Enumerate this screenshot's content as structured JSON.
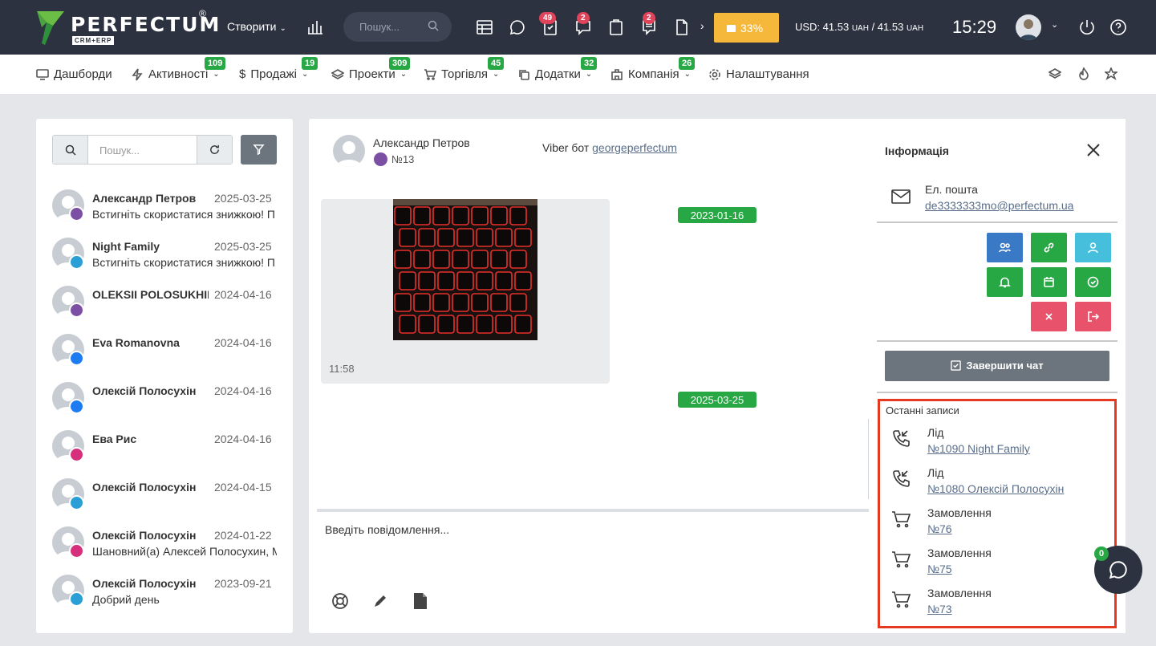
{
  "topbar": {
    "logo_text": "PERFECTUM",
    "logo_reg": "®",
    "logo_sub": "CRM+ERP",
    "create_label": "Створити",
    "search_placeholder": "Пошук...",
    "badge_tasks": "49",
    "badge_messages": "2",
    "badge_notes": "2",
    "progress_label": "33%",
    "currency_label": "USD: 41.53",
    "currency_unit1": "UAH",
    "currency_sep": " / 41.53 ",
    "currency_unit2": "UAH",
    "time": "15:29",
    "accent": "#f5b83a"
  },
  "nav": {
    "items": [
      {
        "label": "Дашборди",
        "icon": "monitor-icon",
        "badge": ""
      },
      {
        "label": "Активності",
        "icon": "bolt-icon",
        "badge": "109"
      },
      {
        "label": "Продажі",
        "icon": "dollar-icon",
        "badge": "19"
      },
      {
        "label": "Проекти",
        "icon": "layers-icon",
        "badge": "309"
      },
      {
        "label": "Торгівля",
        "icon": "cart-icon",
        "badge": "45"
      },
      {
        "label": "Додатки",
        "icon": "copy-icon",
        "badge": "32"
      },
      {
        "label": "Компанія",
        "icon": "building-icon",
        "badge": "26"
      },
      {
        "label": "Налаштування",
        "icon": "gear-icon",
        "badge": ""
      }
    ]
  },
  "chatlist": {
    "search_placeholder": "Пошук...",
    "items": [
      {
        "name": "Александр Петров",
        "date": "2025-03-25",
        "message": "Встигніть скористатися знижкою! П",
        "source": "viber-icon",
        "color": "#7b4fa3"
      },
      {
        "name": "Night Family",
        "date": "2025-03-25",
        "message": "Встигніть скористатися знижкою! П",
        "source": "telegram-icon",
        "color": "#2a9fd6"
      },
      {
        "name": "OLEKSII POLOSUKHIN",
        "date": "2024-04-16",
        "message": "",
        "source": "viber-icon",
        "color": "#7b4fa3"
      },
      {
        "name": "Eva Romanovna",
        "date": "2024-04-16",
        "message": "",
        "source": "messenger-icon",
        "color": "#1e7cf2"
      },
      {
        "name": "Олексій Полосухін",
        "date": "2024-04-16",
        "message": "",
        "source": "messenger-icon",
        "color": "#1e7cf2"
      },
      {
        "name": "Ева Рис",
        "date": "2024-04-16",
        "message": "",
        "source": "instagram-icon",
        "color": "#d6307c"
      },
      {
        "name": "Олексій Полосухін",
        "date": "2024-04-15",
        "message": "",
        "source": "telegram-icon",
        "color": "#2a9fd6"
      },
      {
        "name": "Олексій Полосухін",
        "date": "2024-01-22",
        "message": "Шановний(а) Алексей Полосухин, М",
        "source": "instagram-icon",
        "color": "#d6307c"
      },
      {
        "name": "Олексій Полосухін",
        "date": "2023-09-21",
        "message": "Добрий день",
        "source": "telegram-icon",
        "color": "#2a9fd6"
      }
    ]
  },
  "chat": {
    "contact_name": "Александр Петров",
    "contact_number": "№13",
    "bot_label": "Viber бот",
    "bot_link": "georgeperfectum",
    "date1": "2023-01-16",
    "date2": "2025-03-25",
    "image_time": "11:58",
    "input_placeholder": "Введіть повідомлення..."
  },
  "info": {
    "title": "Інформація",
    "email_label": "Ел. пошта",
    "email_value": "de3333333mo@perfectum.ua",
    "finish_button": "Завершити чат",
    "recent_title": "Останні записи",
    "recent": [
      {
        "type": "Лід",
        "link": "№1090 Night Family",
        "icon": "phone-incoming-icon"
      },
      {
        "type": "Лід",
        "link": "№1080 Олексій Полосухін",
        "icon": "phone-incoming-icon"
      },
      {
        "type": "Замовлення",
        "link": "№76",
        "icon": "cart-icon"
      },
      {
        "type": "Замовлення",
        "link": "№75",
        "icon": "cart-icon"
      },
      {
        "type": "Замовлення",
        "link": "№73",
        "icon": "cart-icon"
      }
    ]
  },
  "float_chat": {
    "badge": "0"
  }
}
